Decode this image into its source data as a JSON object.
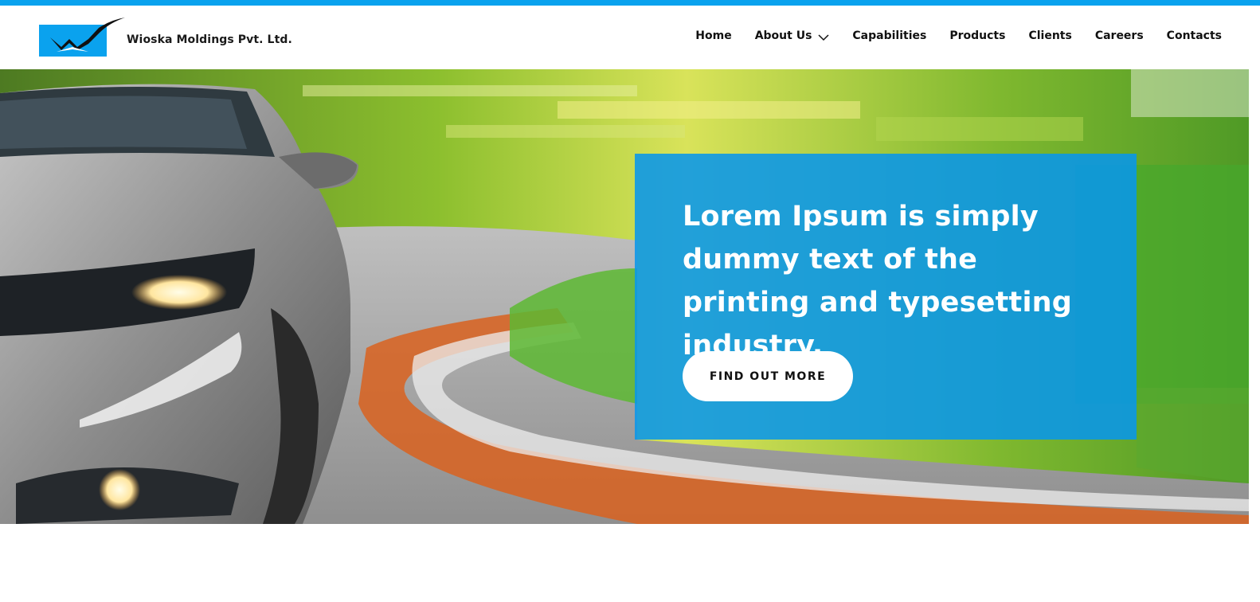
{
  "brand": {
    "name": "Wioska Moldings Pvt. Ltd.",
    "logo_icon": "wm-logo-icon",
    "accent_color": "#0aa2ee"
  },
  "nav": {
    "items": [
      {
        "label": "Home"
      },
      {
        "label": "About Us",
        "icon": "chevron-down-icon"
      },
      {
        "label": "Capabilities"
      },
      {
        "label": "Products"
      },
      {
        "label": "Clients"
      },
      {
        "label": "Careers"
      },
      {
        "label": "Contacts"
      }
    ]
  },
  "hero": {
    "title": "Lorem Ipsum is simply dummy text of the printing and typesetting industry.",
    "cta_label": "FIND OUT MORE",
    "panel_color": "#0896eb"
  }
}
